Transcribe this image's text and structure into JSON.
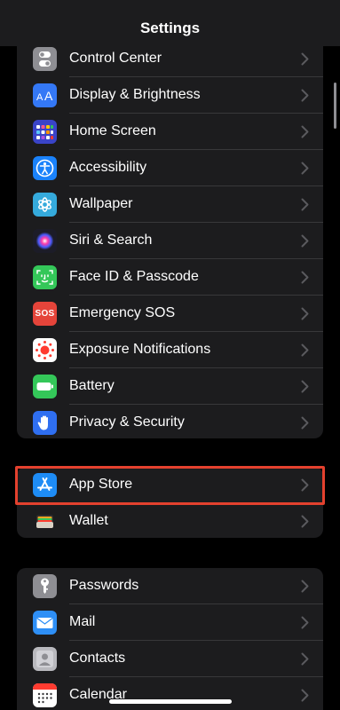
{
  "header": {
    "title": "Settings"
  },
  "group1": [
    {
      "label": "Control Center",
      "icon": "control-center-icon",
      "color": "#8e8e93"
    },
    {
      "label": "Display & Brightness",
      "icon": "display-brightness-icon",
      "color": "#3478f6"
    },
    {
      "label": "Home Screen",
      "icon": "home-screen-icon",
      "color": "#3a44c8"
    },
    {
      "label": "Accessibility",
      "icon": "accessibility-icon",
      "color": "#1a82fb"
    },
    {
      "label": "Wallpaper",
      "icon": "wallpaper-icon",
      "color": "#35aadc"
    },
    {
      "label": "Siri & Search",
      "icon": "siri-icon",
      "color": "#1c1c28"
    },
    {
      "label": "Face ID & Passcode",
      "icon": "face-id-icon",
      "color": "#34c759"
    },
    {
      "label": "Emergency SOS",
      "icon": "sos-icon",
      "color": "#e5443a"
    },
    {
      "label": "Exposure Notifications",
      "icon": "exposure-notifications-icon",
      "color": "#ffffff"
    },
    {
      "label": "Battery",
      "icon": "battery-icon",
      "color": "#34c759"
    },
    {
      "label": "Privacy & Security",
      "icon": "privacy-hand-icon",
      "color": "#2f6ff1"
    }
  ],
  "group2": [
    {
      "label": "App Store",
      "icon": "app-store-icon",
      "color": "#1e8cf5"
    },
    {
      "label": "Wallet",
      "icon": "wallet-icon",
      "color": "#1c1c1e"
    }
  ],
  "group3": [
    {
      "label": "Passwords",
      "icon": "key-icon",
      "color": "#8e8e93"
    },
    {
      "label": "Mail",
      "icon": "mail-icon",
      "color": "#2e8ff6"
    },
    {
      "label": "Contacts",
      "icon": "contacts-icon",
      "color": "#b9b9be"
    },
    {
      "label": "Calendar",
      "icon": "calendar-icon",
      "color": "#ffffff"
    }
  ],
  "sos_text": "SOS",
  "accent": {
    "highlight": "#e3412e"
  }
}
